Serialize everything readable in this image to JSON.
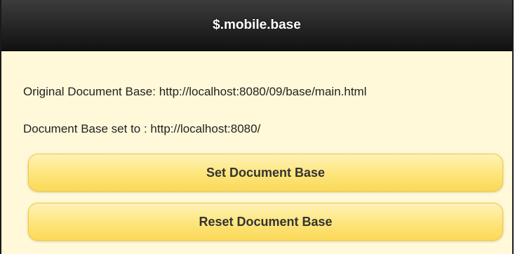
{
  "header": {
    "title": "$.mobile.base"
  },
  "content": {
    "original_base_text": "Original Document Base: http://localhost:8080/09/base/main.html",
    "set_base_text": "Document Base set to : http://localhost:8080/"
  },
  "buttons": {
    "set_label": "Set Document Base",
    "reset_label": "Reset Document Base"
  }
}
